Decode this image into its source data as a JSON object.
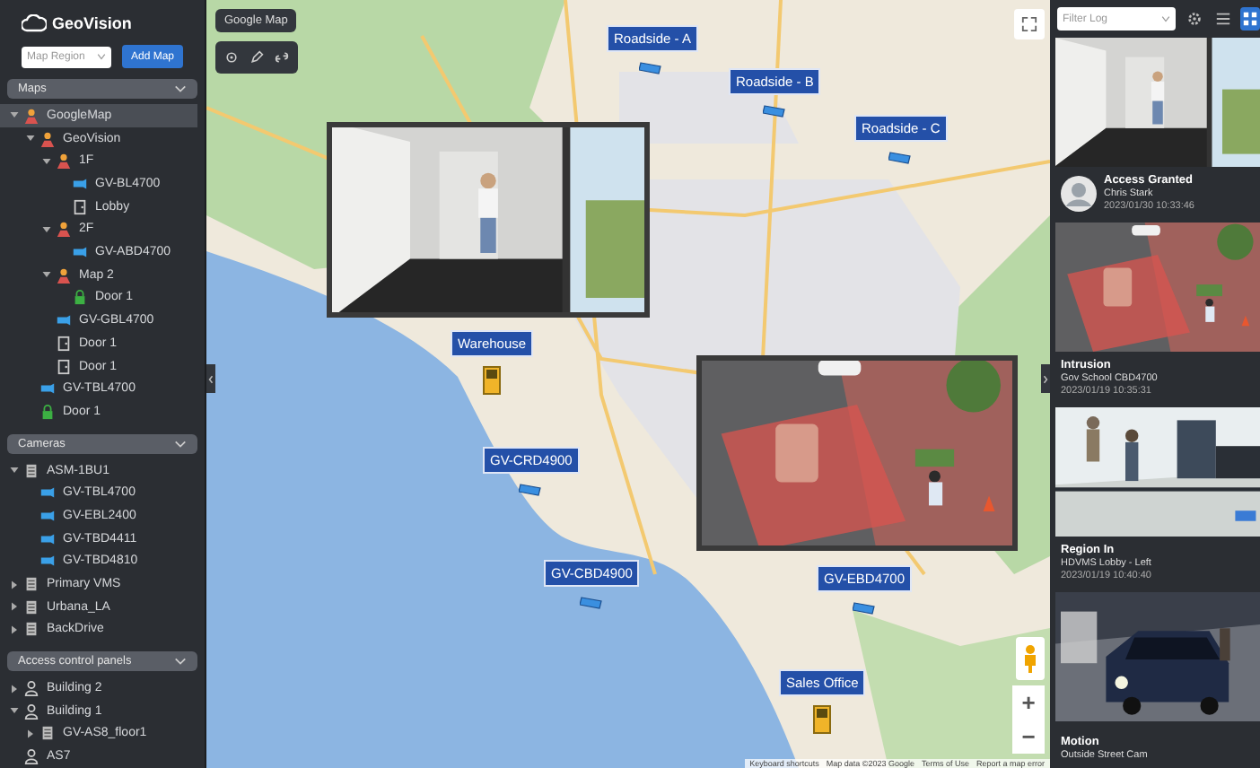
{
  "sidebar": {
    "logo": "GeoVision",
    "map_select": {
      "placeholder": "Map Region"
    },
    "add_button": "Add Map",
    "sections": [
      {
        "title": "Maps",
        "expanded": true,
        "items": [
          {
            "label": "GoogleMap",
            "kind": "map",
            "selected": true,
            "expanded": true,
            "children": [
              {
                "label": "GeoVision",
                "kind": "map",
                "selected": false,
                "expanded": true,
                "children": [
                  {
                    "label": "1F",
                    "kind": "map",
                    "selected": false,
                    "expanded": true,
                    "children": [
                      {
                        "label": "GV-BL4700",
                        "kind": "camera",
                        "selected": false
                      },
                      {
                        "label": "Lobby",
                        "kind": "door",
                        "selected": false
                      }
                    ]
                  },
                  {
                    "label": "2F",
                    "kind": "map",
                    "selected": false,
                    "expanded": true,
                    "children": [
                      {
                        "label": "GV-ABD4700",
                        "kind": "camera",
                        "selected": false
                      }
                    ]
                  },
                  {
                    "label": "Map 2",
                    "kind": "map",
                    "selected": false,
                    "expanded": true,
                    "children": [
                      {
                        "label": "Door 1",
                        "kind": "lock",
                        "selected": false
                      }
                    ]
                  },
                  {
                    "label": "GV-GBL4700",
                    "kind": "camera",
                    "selected": false
                  },
                  {
                    "label": "Door 1",
                    "kind": "door",
                    "selected": false
                  },
                  {
                    "label": "Door 1",
                    "kind": "door",
                    "selected": false
                  }
                ]
              },
              {
                "label": "GV-TBL4700",
                "kind": "camera",
                "selected": false
              },
              {
                "label": "Door 1",
                "kind": "lock",
                "selected": false
              }
            ]
          }
        ]
      },
      {
        "title": "Cameras",
        "expanded": true,
        "items": [
          {
            "label": "ASM-1BU1",
            "kind": "server",
            "selected": false,
            "expanded": true,
            "children": [
              {
                "label": "GV-TBL4700",
                "kind": "camera",
                "selected": false
              },
              {
                "label": "GV-EBL2400",
                "kind": "camera",
                "selected": false
              },
              {
                "label": "GV-TBD4411",
                "kind": "camera",
                "selected": false
              },
              {
                "label": "GV-TBD4810",
                "kind": "camera",
                "selected": false
              }
            ]
          },
          {
            "label": "Primary VMS",
            "kind": "server",
            "selected": false,
            "expanded": false
          },
          {
            "label": "Urbana_LA",
            "kind": "server",
            "selected": false,
            "expanded": false
          },
          {
            "label": "BackDrive",
            "kind": "server",
            "selected": false,
            "expanded": false
          }
        ]
      },
      {
        "title": "Access control panels",
        "expanded": true,
        "items": [
          {
            "label": "Building 2",
            "kind": "building",
            "selected": false,
            "expanded": false
          },
          {
            "label": "Building 1",
            "kind": "building",
            "selected": false,
            "expanded": true,
            "children": [
              {
                "label": "GV-AS8_floor1",
                "kind": "server",
                "selected": false,
                "expanded": false
              }
            ]
          },
          {
            "label": "AS7",
            "kind": "building",
            "selected": false
          }
        ]
      }
    ]
  },
  "map": {
    "title": "Google Map",
    "tools": [
      {
        "kind": "locate"
      },
      {
        "kind": "edit"
      },
      {
        "kind": "link"
      }
    ],
    "markers": [
      {
        "label": "Roadside - A",
        "kind": "camera",
        "popup": false
      },
      {
        "label": "Roadside - B",
        "kind": "camera",
        "popup": false
      },
      {
        "label": "Roadside - C",
        "kind": "camera",
        "popup": false
      },
      {
        "label": "Warehouse",
        "kind": "door",
        "popup": true
      },
      {
        "label": "GV-CRD4900",
        "kind": "camera",
        "popup": false
      },
      {
        "label": "GV-CBD4900",
        "kind": "camera",
        "popup": false
      },
      {
        "label": "GV-EBD4700",
        "kind": "camera",
        "popup": true
      },
      {
        "label": "Sales Office",
        "kind": "door",
        "popup": false
      }
    ],
    "zoom_controls": [
      "+",
      "−"
    ],
    "attribution": [
      "Keyboard shortcuts",
      "Map data ©2023 Google",
      "Terms of Use",
      "Report a map error"
    ]
  },
  "events": {
    "filter": {
      "placeholder": "Filter Log"
    },
    "view_buttons": [
      {
        "kind": "settings",
        "selected": false
      },
      {
        "kind": "list",
        "selected": false
      },
      {
        "kind": "grid",
        "selected": true
      }
    ],
    "cards": [
      {
        "title": "Access Granted",
        "subtitle": "Chris Stark",
        "time": "2023/01/30 10:33:46",
        "avatar": true
      },
      {
        "title": "Intrusion",
        "subtitle": "Gov School CBD4700",
        "time": "2023/01/19 10:35:31",
        "avatar": false
      },
      {
        "title": "Region In",
        "subtitle": "HDVMS Lobby - Left",
        "time": "2023/01/19 10:40:40",
        "avatar": false
      },
      {
        "title": "Motion",
        "subtitle": "Outside Street Cam",
        "avatar": false
      }
    ]
  }
}
